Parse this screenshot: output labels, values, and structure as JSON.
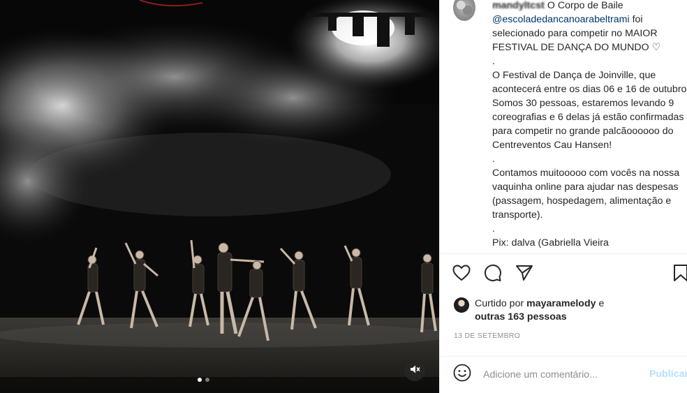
{
  "post": {
    "username": "mandyltcst",
    "caption_intro": "O Corpo de Baile",
    "mention": "@escoladedancanoarabeltrami",
    "caption_line1": "foi selecionado para competir no MAIOR FESTIVAL DE DANÇA DO MUNDO ♡",
    "dot1": ".",
    "caption_para2": "O Festival de Dança de Joinville, que acontecerá entre os dias 06 e 16 de outubro. Somos 30 pessoas, estaremos levando 9 coreografias e 6 delas já estão confirmadas para competir no grande palcãoooooo do Centreventos Cau Hansen!",
    "dot2": ".",
    "caption_para3": "Contamos muitooooo com vocês na nossa vaquinha online para ajudar nas despesas (passagem, hospedagem, alimentação e transporte).",
    "dot3": ".",
    "caption_cut": "Pix: dalva (Gabriella Vieira"
  },
  "likes": {
    "prefix": "Curtido por",
    "user": "mayaramelody",
    "connector": "e",
    "others": "outras 163 pessoas"
  },
  "date": "13 DE SETEMBRO",
  "comment": {
    "placeholder": "Adicione um comentário...",
    "publish_label": "Publicar"
  },
  "media": {
    "carousel_count": 2,
    "carousel_active": 1,
    "muted": true
  },
  "icons": {
    "like": "heart-icon",
    "comment": "comment-icon",
    "share": "share-icon",
    "save": "bookmark-icon",
    "emoji": "emoji-icon",
    "mute": "speaker-muted-icon"
  },
  "colors": {
    "mention": "#00376b",
    "muted_text": "#8e8e8e",
    "publish_disabled": "#b2dffc"
  }
}
